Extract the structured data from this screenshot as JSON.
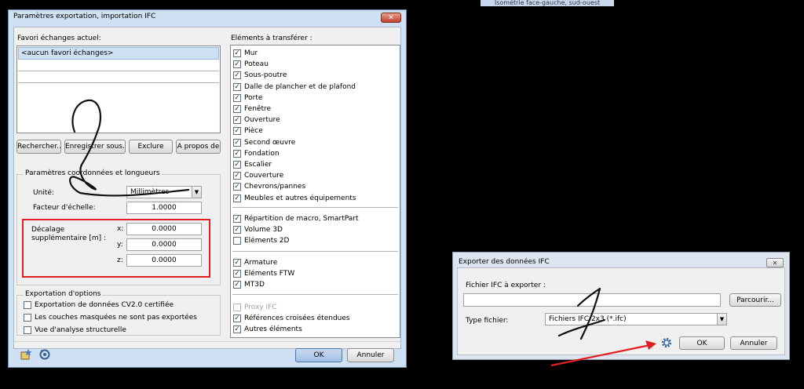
{
  "top_chip": "Isométrie face-gauche, sud-ouest",
  "dialog_main": {
    "title": "Paramètres exportation, importation IFC",
    "close_label": "✕",
    "favorites_label": "Favori échanges actuel:",
    "favorites_items": [
      "<aucun favori échanges>"
    ],
    "buttons": {
      "search": "Rechercher...",
      "save": "Enregistrer sous...",
      "exclude": "Exclure",
      "about": "A propos de"
    },
    "coords_group": {
      "title": "Paramètres coordonnées et longueurs",
      "unit_label": "Unité:",
      "unit_value": "Millimètres",
      "scale_label": "Facteur d'échelle:",
      "scale_value": "1.0000",
      "offset_label": "Décalage supplémentaire [m] :",
      "x_label": "x:",
      "x_value": "0.0000",
      "y_label": "y:",
      "y_value": "0.0000",
      "z_label": "z:",
      "z_value": "0.0000"
    },
    "options_group": {
      "title": "Exportation d'options",
      "items": [
        {
          "label": "Exportation de données CV2.0 certifiée",
          "checked": false
        },
        {
          "label": "Les couches masquées ne sont pas exportées",
          "checked": false
        },
        {
          "label": "Vue d'analyse structurelle",
          "checked": false
        }
      ]
    },
    "elements_label": "Eléments à transférer :",
    "elements": [
      {
        "label": "Mur",
        "checked": true
      },
      {
        "label": "Poteau",
        "checked": true
      },
      {
        "label": "Sous-poutre",
        "checked": true
      },
      {
        "label": "Dalle de plancher et de plafond",
        "checked": true
      },
      {
        "label": "Porte",
        "checked": true
      },
      {
        "label": "Fenêtre",
        "checked": true
      },
      {
        "label": "Ouverture",
        "checked": true
      },
      {
        "label": "Pièce",
        "checked": true
      },
      {
        "label": "Second œuvre",
        "checked": true
      },
      {
        "label": "Fondation",
        "checked": true
      },
      {
        "label": "Escalier",
        "checked": true
      },
      {
        "label": "Couverture",
        "checked": true
      },
      {
        "label": "Chevrons/pannes",
        "checked": true
      },
      {
        "label": "Meubles et autres équipements",
        "checked": true
      }
    ],
    "elements_group2": [
      {
        "label": "Répartition de macro, SmartPart",
        "checked": true
      },
      {
        "label": "Volume 3D",
        "checked": true
      },
      {
        "label": "Eléments 2D",
        "checked": false
      }
    ],
    "elements_group3": [
      {
        "label": "Armature",
        "checked": true
      },
      {
        "label": "Eléments FTW",
        "checked": true
      },
      {
        "label": "MT3D",
        "checked": true
      }
    ],
    "elements_group4": [
      {
        "label": "Proxy IFC",
        "checked": false,
        "disabled": true
      },
      {
        "label": "Références croisées étendues",
        "checked": true
      },
      {
        "label": "Autres éléments",
        "checked": true
      }
    ],
    "ok_label": "OK",
    "cancel_label": "Annuler",
    "bottom_icons": [
      "favorites-icon",
      "reset-icon"
    ]
  },
  "dialog_export": {
    "title": "Exporter des données IFC",
    "close_label": "✕",
    "file_label": "Fichier IFC à exporter :",
    "file_value": "",
    "browse_label": "Parcourir...",
    "type_label": "Type fichier:",
    "type_value": "Fichiers IFC 2x3 (*.ifc)",
    "settings_icon": "gear-icon",
    "ok_label": "OK",
    "cancel_label": "Annuler"
  },
  "colors": {
    "annotation_box": "#e02020",
    "annotation_arrow": "#e02020",
    "default_button": "#9fc0e4"
  }
}
